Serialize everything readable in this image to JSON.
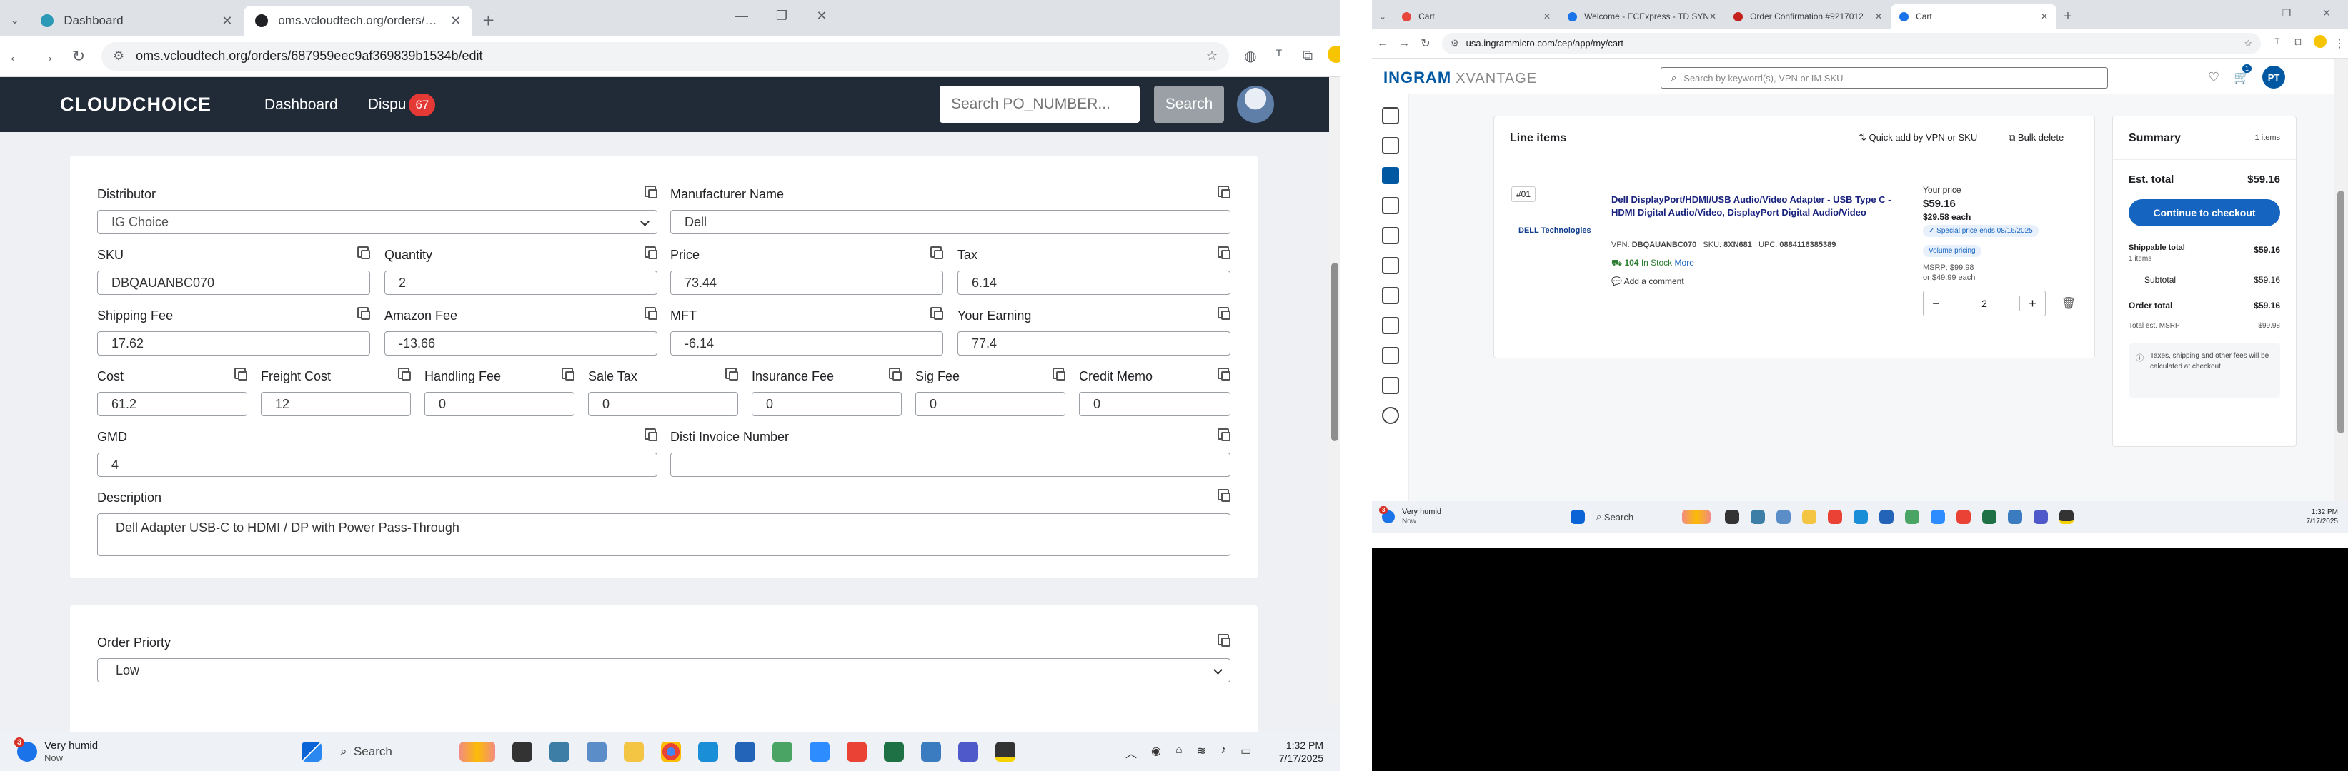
{
  "left_browser": {
    "tabs": [
      {
        "title": "Dashboard",
        "favicon_color": "#2c9ab7",
        "active": false
      },
      {
        "title": "oms.vcloudtech.org/orders/687",
        "favicon_color": "#202124",
        "active": true
      }
    ],
    "url": "oms.vcloudtech.org/orders/687959eec9af369839b1534b/edit"
  },
  "app": {
    "logo": "CLOUDCHOICE",
    "nav": {
      "dashboard": "Dashboard",
      "disputes": "Dispu",
      "disputes_badge": "67"
    },
    "search_placeholder": "Search PO_NUMBER...",
    "search_button": "Search"
  },
  "form": {
    "distributor": {
      "label": "Distributor",
      "value": "IG Choice"
    },
    "manufacturer": {
      "label": "Manufacturer Name",
      "value": "Dell"
    },
    "sku": {
      "label": "SKU",
      "value": "DBQAUANBC070"
    },
    "quantity": {
      "label": "Quantity",
      "value": "2"
    },
    "price": {
      "label": "Price",
      "value": "73.44"
    },
    "tax": {
      "label": "Tax",
      "value": "6.14"
    },
    "shipping_fee": {
      "label": "Shipping Fee",
      "value": "17.62"
    },
    "amazon_fee": {
      "label": "Amazon Fee",
      "value": "-13.66"
    },
    "mft": {
      "label": "MFT",
      "value": "-6.14"
    },
    "your_earning": {
      "label": "Your Earning",
      "value": "77.4"
    },
    "cost": {
      "label": "Cost",
      "value": "61.2"
    },
    "freight_cost": {
      "label": "Freight Cost",
      "value": "12"
    },
    "handling_fee": {
      "label": "Handling Fee",
      "value": "0"
    },
    "sale_tax": {
      "label": "Sale Tax",
      "value": "0"
    },
    "insurance_fee": {
      "label": "Insurance Fee",
      "value": "0"
    },
    "sig_fee": {
      "label": "Sig Fee",
      "value": "0"
    },
    "credit_memo": {
      "label": "Credit Memo",
      "value": "0"
    },
    "gmd": {
      "label": "GMD",
      "value": "4"
    },
    "disti_invoice": {
      "label": "Disti Invoice Number",
      "value": ""
    },
    "description": {
      "label": "Description",
      "value": "Dell Adapter USB-C to HDMI / DP with Power Pass-Through"
    },
    "order_priority": {
      "label": "Order Priorty",
      "value": "Low"
    }
  },
  "taskbar": {
    "weather_title": "Very humid",
    "weather_sub": "Now",
    "weather_badge": "3",
    "search": "Search",
    "time": "1:32 PM",
    "date": "7/17/2025"
  },
  "right_browser": {
    "tabs": [
      {
        "title": "Cart",
        "favicon_color": "#e8453c"
      },
      {
        "title": "Welcome - ECExpress - TD SYN",
        "favicon_color": "#1a73e8"
      },
      {
        "title": "Order Confirmation #9217012",
        "favicon_color": "#c5221f"
      },
      {
        "title": "Cart",
        "favicon_color": "#1a73e8"
      }
    ],
    "url": "usa.ingrammicro.com/cep/app/my/cart"
  },
  "ingram": {
    "logo_main": "INGRAM",
    "logo_sub": "XVANTAGE",
    "search_placeholder": "Search by keyword(s), VPN or IM SKU",
    "cart_badge": "1",
    "user_initials": "PT",
    "line_items_title": "Line items",
    "quick_add": "Quick add by VPN or SKU",
    "bulk_delete": "Bulk delete",
    "item_index": "#01",
    "brand": "DELL Technologies",
    "product_title": "Dell DisplayPort/HDMI/USB Audio/Video Adapter - USB Type C - HDMI Digital Audio/Video, DisplayPort Digital Audio/Video",
    "vpn_label": "VPN:",
    "vpn": "DBQAUANBC070",
    "sku_label": "SKU:",
    "sku": "8XN681",
    "upc_label": "UPC:",
    "upc": "0884116385389",
    "stock_qty": "104",
    "stock_text": "In Stock",
    "more": "More",
    "add_comment": "Add a comment",
    "your_price_label": "Your price",
    "price": "$59.16",
    "price_each": "$29.58 each",
    "special_price": "Special price ends 08/16/2025",
    "volume_pricing": "Volume pricing",
    "msrp_line": "MSRP: $99.98",
    "msrp_each": "or $49.99 each",
    "qty": "2",
    "summary_title": "Summary",
    "summary_items": "1 items",
    "est_total_label": "Est. total",
    "est_total": "$59.16",
    "checkout_button": "Continue to checkout",
    "shippable_total_label": "Shippable total",
    "shippable_items": "1 items",
    "shippable_total": "$59.16",
    "subtotal_label": "Subtotal",
    "subtotal": "$59.16",
    "order_total_label": "Order total",
    "order_total": "$59.16",
    "total_msrp_label": "Total est. MSRP",
    "total_msrp": "$99.98",
    "tax_note": "Taxes, shipping and other fees will be calculated at checkout"
  },
  "colors": {
    "app_header": "#212b38",
    "accent_blue": "#0058a3",
    "checkout_blue": "#1565c0",
    "badge_red": "#e53935"
  }
}
